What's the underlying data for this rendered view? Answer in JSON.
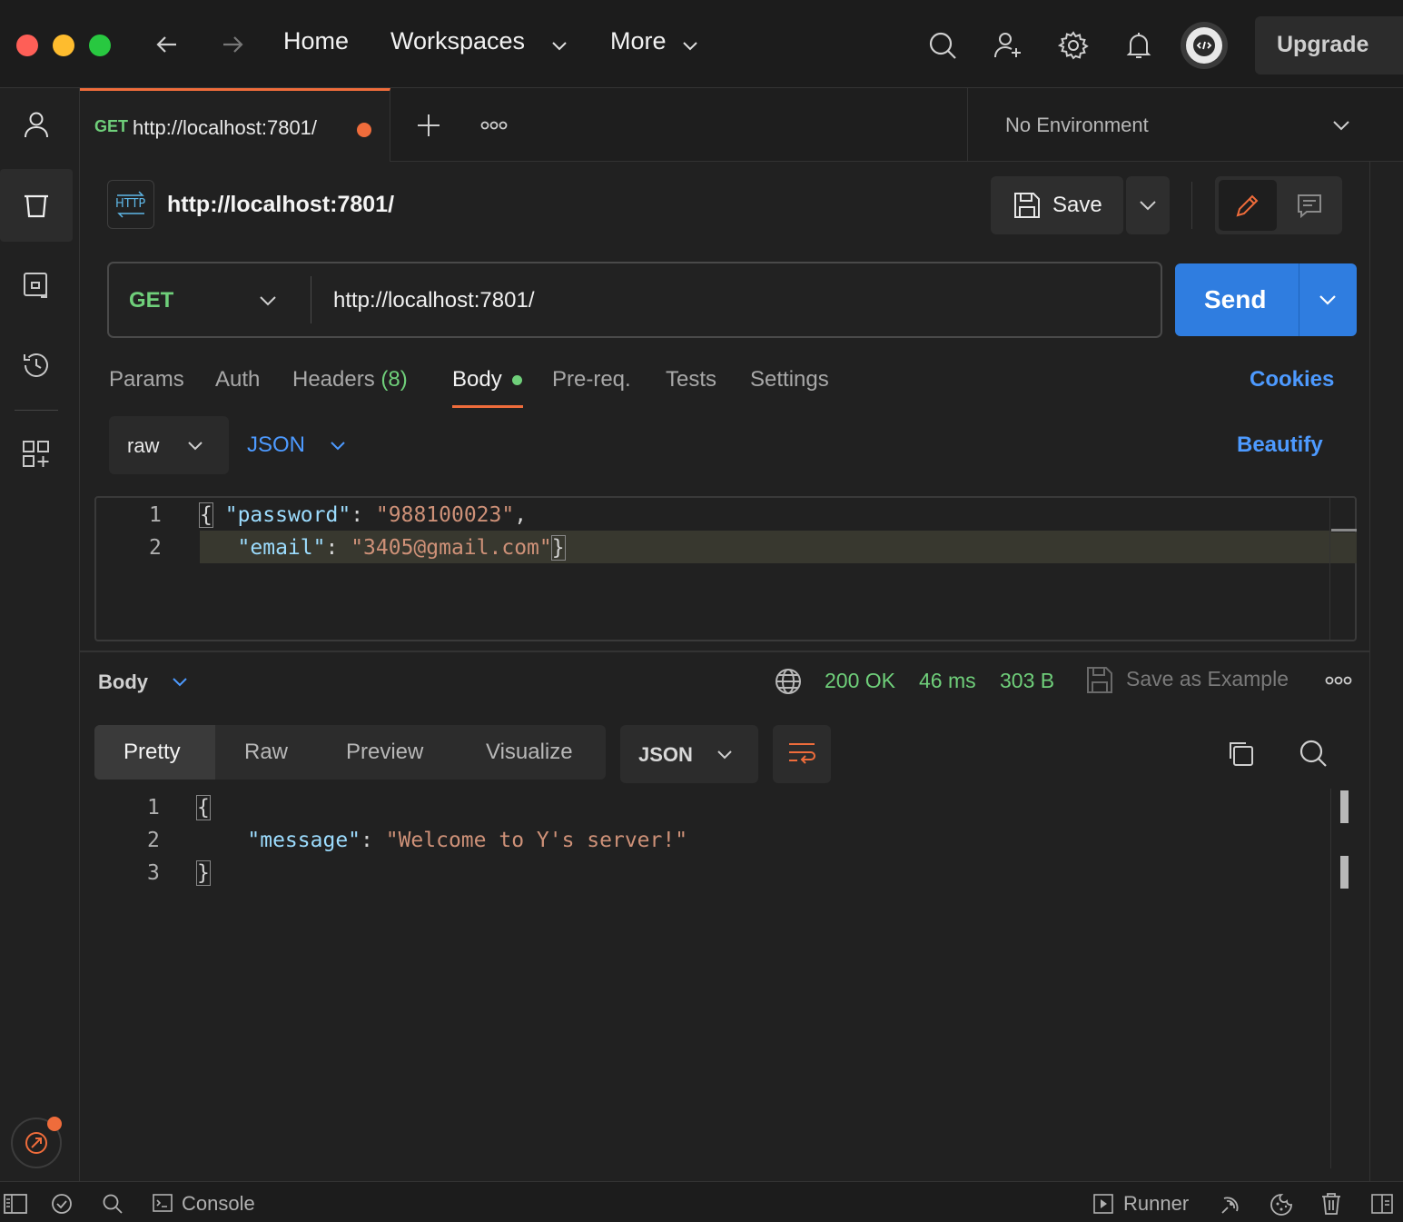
{
  "topbar": {
    "nav": {
      "home": "Home",
      "workspaces": "Workspaces",
      "more": "More"
    },
    "upgrade_label": "Upgrade"
  },
  "tabs": {
    "active": {
      "method": "GET",
      "title": "http://localhost:7801/"
    },
    "environment": "No Environment"
  },
  "request": {
    "name": "http://localhost:7801/",
    "save_label": "Save",
    "method": "GET",
    "url": "http://localhost:7801/",
    "send_label": "Send",
    "subtabs": {
      "params": "Params",
      "auth": "Auth",
      "headers": "Headers",
      "headers_count": "(8)",
      "body": "Body",
      "prereq": "Pre-req.",
      "tests": "Tests",
      "settings": "Settings",
      "cookies": "Cookies"
    },
    "body_mode": "raw",
    "body_format": "JSON",
    "beautify_label": "Beautify",
    "body_lines": {
      "l1_num": "1",
      "l1_brace": "{",
      "l1_key": "\"password\"",
      "l1_colon": ": ",
      "l1_val": "\"988100023\"",
      "l1_comma": ",",
      "l2_num": "2",
      "l2_key": "\"email\"",
      "l2_colon": ": ",
      "l2_val": "\"3405@gmail.com\"",
      "l2_brace": "}"
    }
  },
  "response": {
    "section_label": "Body",
    "status": "200 OK",
    "time": "46 ms",
    "size": "303 B",
    "save_example_label": "Save as Example",
    "views": {
      "pretty": "Pretty",
      "raw": "Raw",
      "preview": "Preview",
      "visualize": "Visualize"
    },
    "format": "JSON",
    "lines": {
      "l1_num": "1",
      "l1_brace": "{",
      "l2_num": "2",
      "l2_key": "\"message\"",
      "l2_colon": ": ",
      "l2_val": "\"Welcome to Y's server!\"",
      "l3_num": "3",
      "l3_brace": "}"
    }
  },
  "bottombar": {
    "console": "Console",
    "runner": "Runner"
  },
  "colors": {
    "accent_orange": "#ef6c3b",
    "send_blue": "#2f7de0",
    "link_blue": "#4d9aff",
    "status_green": "#6fcf7a",
    "method_green": "#6fcf7a"
  }
}
